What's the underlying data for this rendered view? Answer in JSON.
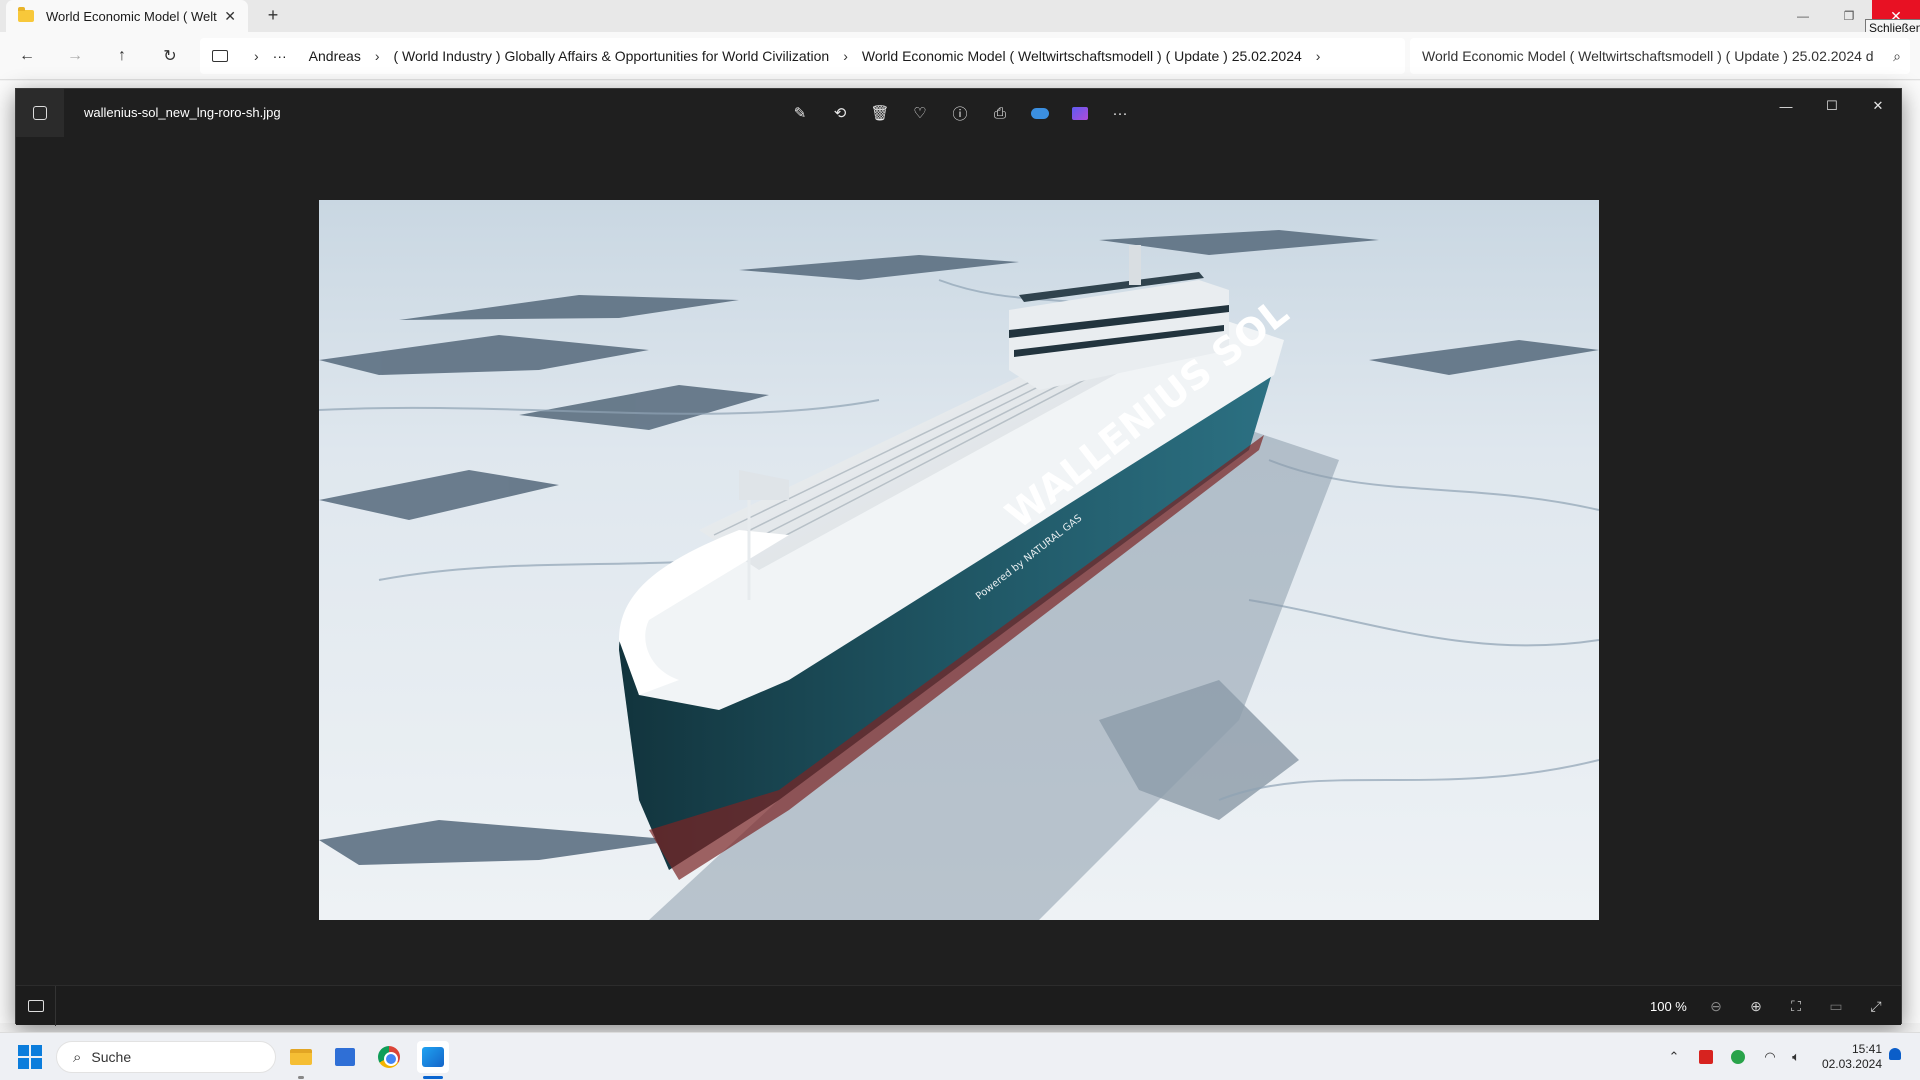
{
  "explorer": {
    "tab_title": "World Economic Model ( Welt",
    "tab_close": "✕",
    "new_tab": "+",
    "close_tooltip": "Schließen",
    "breadcrumb": [
      "Andreas",
      "( World Industry ) Globally Affairs & Opportunities for World Civilization",
      "World Economic Model ( Weltwirtschaftsmodell ) ( Update ) 25.02.2024"
    ],
    "overflow": "···",
    "search_value": "World Economic Model ( Weltwirtschaftsmodell ) ( Update ) 25.02.2024 d"
  },
  "viewer": {
    "file_name": "wallenius-sol_new_lng-roro-sh.jpg",
    "zoom": "100 %",
    "toolbar": [
      "edit-image-icon",
      "rotate-icon",
      "delete-icon",
      "favorite-icon",
      "info-icon",
      "print-icon",
      "onedrive-icon",
      "clipchamp-icon",
      "more-icon"
    ],
    "photo": {
      "hull_text": "WALLENIUS SOL",
      "hull_subtext": "Powered by NATURAL GAS",
      "colors": {
        "ice": "#e9eff4",
        "water": "#4d6174",
        "hull": "#1d4d59",
        "deck": "#f2f4f5"
      }
    }
  },
  "taskbar": {
    "search_placeholder": "Suche",
    "time": "15:41",
    "date": "02.03.2024",
    "apps": [
      "file-explorer",
      "microsoft-store",
      "chrome",
      "photos"
    ]
  }
}
